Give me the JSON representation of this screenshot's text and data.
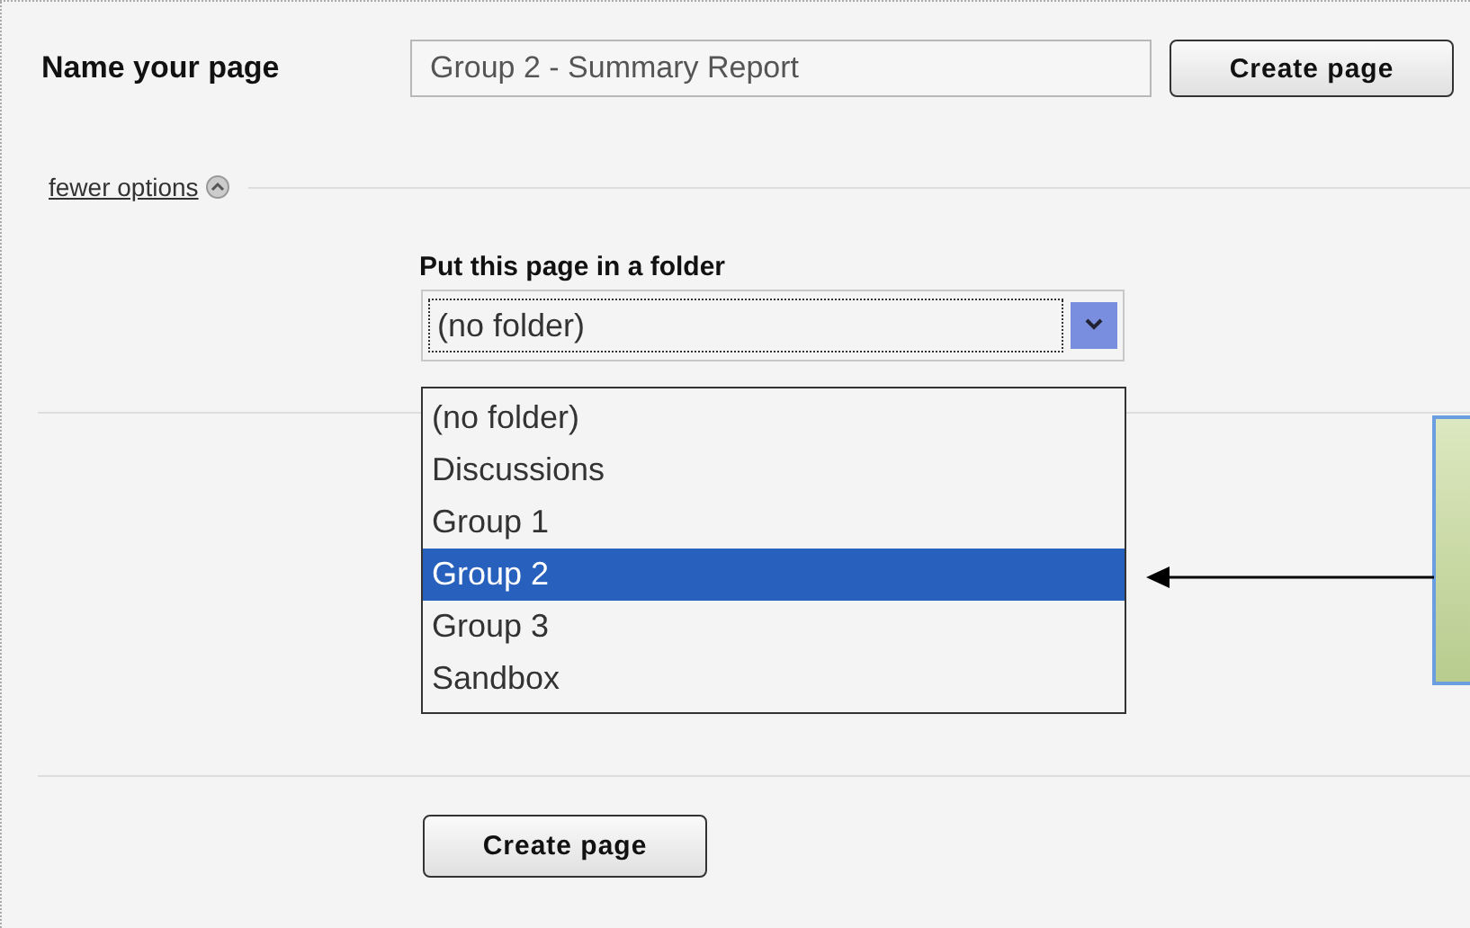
{
  "name_row": {
    "label": "Name your page",
    "field_value": "Group 2 - Summary Report",
    "button": "Create page"
  },
  "options_link": {
    "label": "fewer options",
    "expanded": true
  },
  "folder": {
    "label": "Put this page in a folder",
    "value": "(no folder)",
    "open": true,
    "options": [
      {
        "label": "(no folder)",
        "highlighted": false
      },
      {
        "label": "Discussions",
        "highlighted": false
      },
      {
        "label": "Group 1",
        "highlighted": false
      },
      {
        "label": "Group 2",
        "highlighted": true
      },
      {
        "label": "Group 3",
        "highlighted": false
      },
      {
        "label": "Sandbox",
        "highlighted": false
      }
    ]
  },
  "bottom_button": "Create page"
}
